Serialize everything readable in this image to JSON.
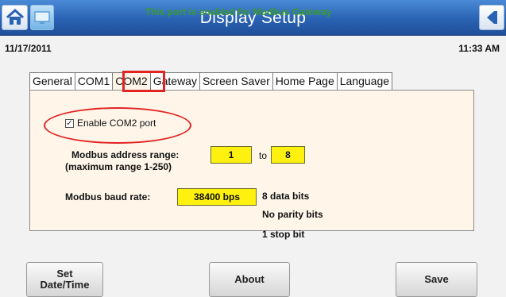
{
  "window": {
    "title": "Display Setup"
  },
  "status": {
    "date": "11/17/2011",
    "time": "11:33 AM"
  },
  "tabs": [
    {
      "label": "General",
      "active": false
    },
    {
      "label": "COM1",
      "active": false
    },
    {
      "label": "COM2",
      "active": true
    },
    {
      "label": "Gateway",
      "active": false
    },
    {
      "label": "Screen Saver",
      "active": false
    },
    {
      "label": "Home Page",
      "active": false
    },
    {
      "label": "Language",
      "active": false
    }
  ],
  "panel": {
    "gateway_message": "This port is enabled for Modbus Gateway",
    "enable_label": "Enable COM2 port",
    "enable_checked": true,
    "address_label_1": "Modbus address range:",
    "address_label_2": "(maximum range 1-250)",
    "address_from": "1",
    "address_to_label": "to",
    "address_to": "8",
    "baud_label": "Modbus baud rate:",
    "baud_value": "38400 bps",
    "data_bits": "8 data bits",
    "parity": "No parity bits",
    "stop_bits": "1 stop bit"
  },
  "buttons": {
    "set_datetime_1": "Set",
    "set_datetime_2": "Date/Time",
    "about": "About",
    "save": "Save"
  },
  "icons": {
    "home": "home-icon",
    "monitor": "monitor-icon",
    "back": "back-arrow-icon"
  },
  "colors": {
    "titlebar": "#2a63b3",
    "panel": "#fff6e9",
    "field": "#fff10f",
    "gateway_text": "#3a9a2c",
    "highlight": "#e22424"
  }
}
